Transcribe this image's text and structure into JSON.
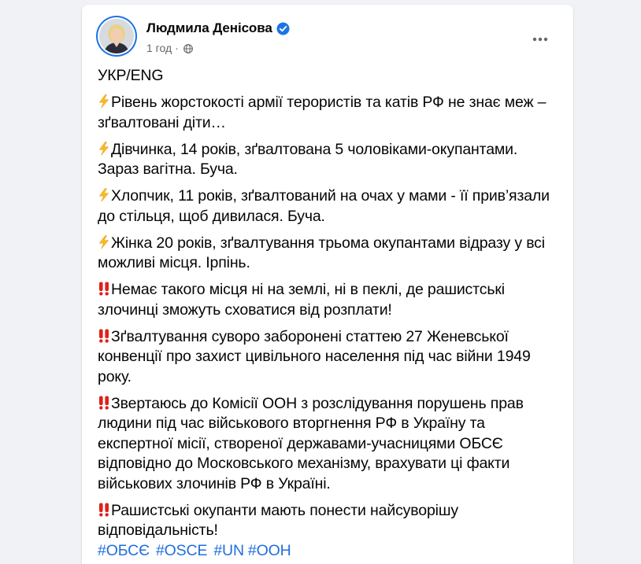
{
  "post": {
    "author": "Людмила Денісова",
    "time": "1 год",
    "separator": "·",
    "verified_icon": "verified-badge-icon",
    "audience_icon": "globe-icon",
    "menu_icon": "more-horizontal-icon",
    "colors": {
      "background": "#f0f2f5",
      "card": "#ffffff",
      "text": "#050505",
      "secondary": "#65676b",
      "accent": "#1b74e4",
      "hashtag": "#216fdb"
    },
    "paragraphs": [
      {
        "emoji": "",
        "text": "УКР/ENG"
      },
      {
        "emoji": "high-voltage",
        "text": "Рівень жорстокості армії терористів та катів РФ не знає меж – зґвалтовані діти…"
      },
      {
        "emoji": "high-voltage",
        "text": "Дівчинка, 14 років, зґвалтована 5 чоловіками-окупантами. Зараз вагітна. Буча."
      },
      {
        "emoji": "high-voltage",
        "text": "Хлопчик, 11 років, зґвалтований на очах у мами - її прив’язали до стільця, щоб дивилася. Буча."
      },
      {
        "emoji": "high-voltage",
        "text": "Жінка 20 років, зґвалтування трьома окупантами відразу у всі можливі місця. Ірпінь."
      },
      {
        "emoji": "double-exclamation",
        "text": "Немає такого місця ні на землі, ні в пеклі, де рашистські злочинці зможуть сховатися від розплати!"
      },
      {
        "emoji": "double-exclamation",
        "text": "Зґвалтування суворо заборонені статтею 27 Женевської конвенції про захист цивільного населення під час війни 1949 року."
      },
      {
        "emoji": "double-exclamation",
        "text": "Звертаюсь до Комісії ООН з розслідування порушень прав людини під час військового вторгнення РФ в Україну та експертної місії, створеної державами-учасницями ОБСЄ відповідно до Московського механізму, врахувати ці факти військових злочинів РФ в Україні."
      },
      {
        "emoji": "double-exclamation",
        "text": "Рашистські окупанти мають понести найсуворішу відповідальність!"
      }
    ],
    "hashtags": [
      "#ОБСЄ",
      "#OSCE",
      "#UN",
      "#ООН"
    ]
  }
}
